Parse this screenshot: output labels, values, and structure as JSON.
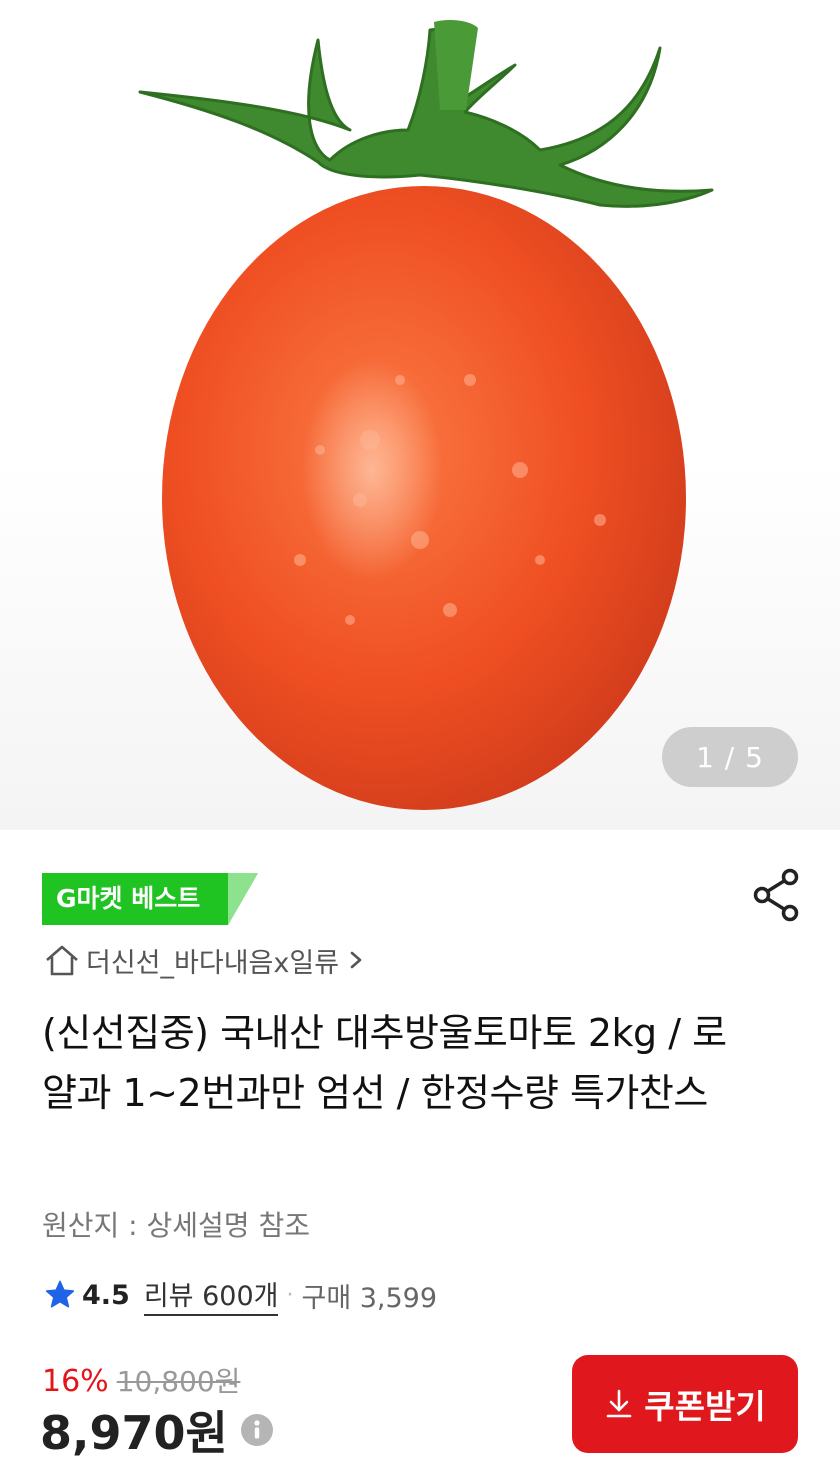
{
  "gallery": {
    "counter": "1 / 5"
  },
  "badge": {
    "label": "G마켓 베스트"
  },
  "seller": {
    "name": "더신선_바다내음x일류"
  },
  "product": {
    "title": "(신선집중) 국내산 대추방울토마토 2kg / 로얄과 1~2번과만 엄선 / 한정수량 특가찬스",
    "origin": "원산지 : 상세설명 참조"
  },
  "stats": {
    "rating": "4.5",
    "review": "리뷰 600개",
    "separator": "·",
    "purchase": "구매 3,599"
  },
  "pricing": {
    "discount": "16%",
    "original_price": "10,800원",
    "price": "8,970원"
  },
  "coupon_button": {
    "label": "쿠폰받기"
  },
  "colors": {
    "accent_red": "#e0171c",
    "badge_green": "#1fc322",
    "star_blue": "#1f64e6"
  },
  "icons": [
    "home-icon",
    "chevron-right-icon",
    "share-icon",
    "star-icon",
    "info-icon",
    "download-icon"
  ]
}
